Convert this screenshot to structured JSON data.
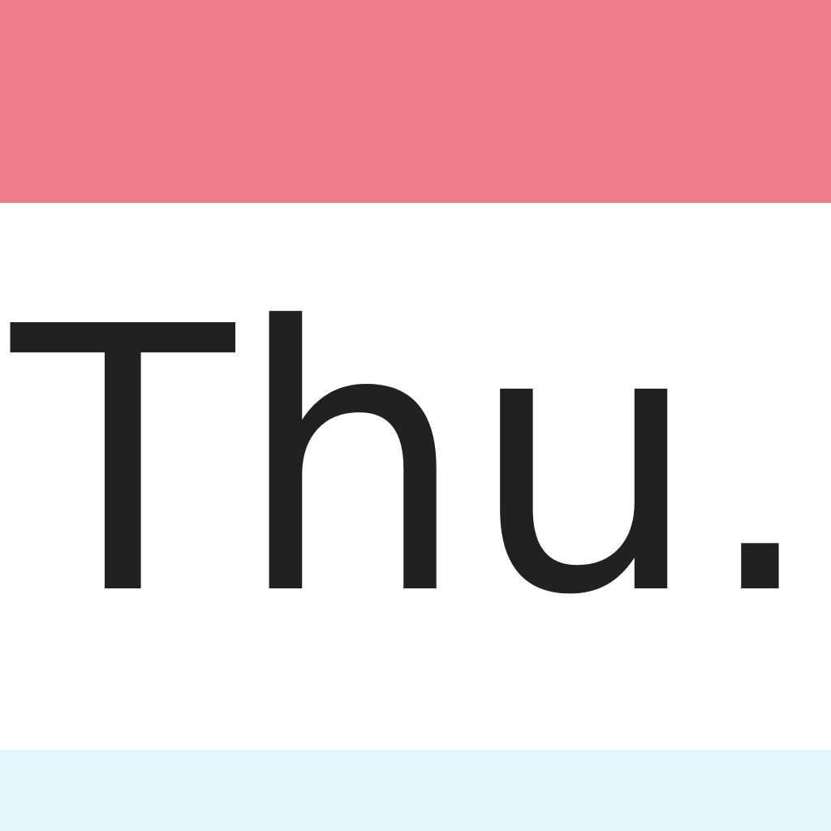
{
  "app_icon": {
    "day_label": "Thu.",
    "colors": {
      "top_band": "#EC7B8C",
      "background": "#FFFFFF",
      "text": "#212121",
      "bottom_band": "#E3F7FD"
    }
  }
}
